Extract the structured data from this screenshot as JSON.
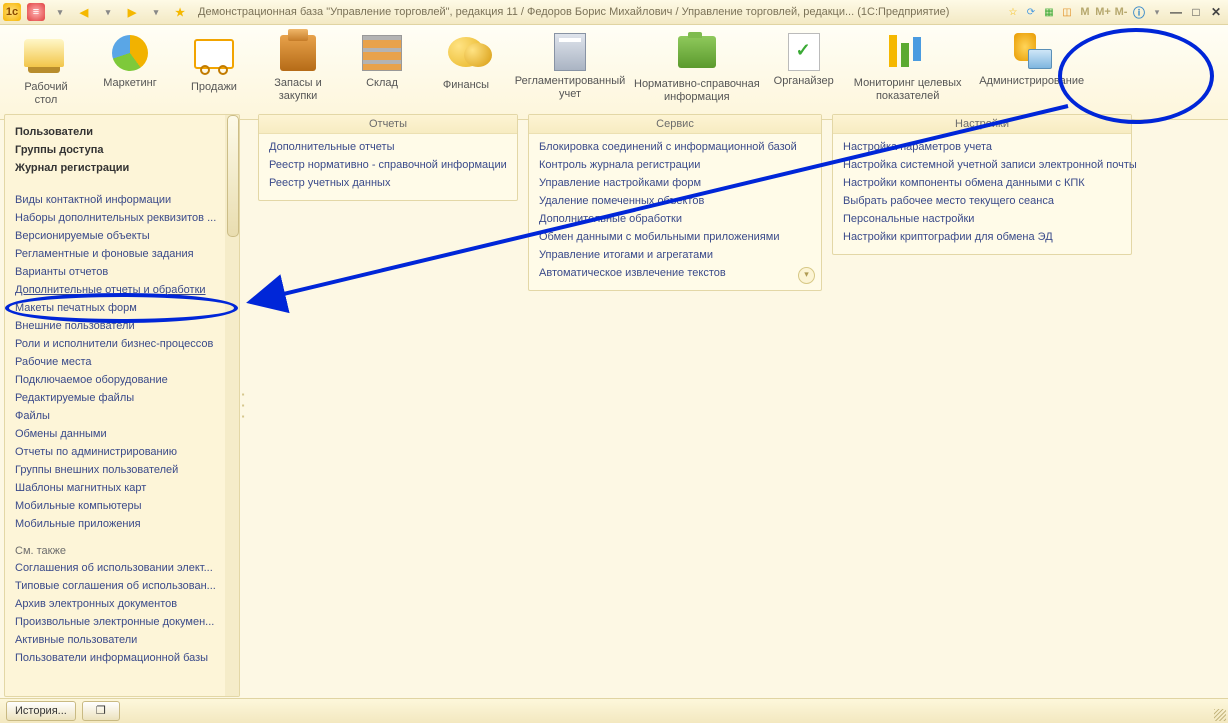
{
  "titlebar": {
    "title": "Демонстрационная база \"Управление торговлей\", редакция 11 / Федоров Борис Михайлович / Управление торговлей, редакци...   (1С:Предприятие)",
    "icons_right": {
      "m1": "M",
      "m2": "M+",
      "m3": "M-"
    }
  },
  "sections": [
    {
      "id": "desktop",
      "label": "Рабочий\nстол"
    },
    {
      "id": "marketing",
      "label": "Маркетинг"
    },
    {
      "id": "sales",
      "label": "Продажи"
    },
    {
      "id": "stock",
      "label": "Запасы и\nзакупки"
    },
    {
      "id": "warehouse",
      "label": "Склад"
    },
    {
      "id": "finance",
      "label": "Финансы"
    },
    {
      "id": "reglament",
      "label": "Регламентированный\nучет"
    },
    {
      "id": "nsi",
      "label": "Нормативно-справочная\nинформация"
    },
    {
      "id": "organizer",
      "label": "Органайзер"
    },
    {
      "id": "monitoring",
      "label": "Мониторинг целевых\nпоказателей"
    },
    {
      "id": "admin",
      "label": "Администрирование"
    }
  ],
  "nav": {
    "bold": [
      "Пользователи",
      "Группы доступа",
      "Журнал регистрации"
    ],
    "links1": [
      "Виды контактной информации",
      "Наборы дополнительных реквизитов ...",
      "Версионируемые объекты",
      "Регламентные и фоновые задания",
      "Варианты отчетов",
      "Дополнительные отчеты и обработки",
      "Макеты печатных форм",
      "Внешние пользователи",
      "Роли и исполнители бизнес-процессов",
      "Рабочие места",
      "Подключаемое оборудование",
      "Редактируемые файлы",
      "Файлы",
      "Обмены данными",
      "Отчеты по администрированию",
      "Группы внешних пользователей",
      "Шаблоны магнитных карт",
      "Мобильные компьютеры",
      "Мобильные приложения"
    ],
    "seealso_hd": "См. также",
    "links2": [
      "Соглашения об использовании элект...",
      "Типовые соглашения об использован...",
      "Архив электронных документов",
      "Произвольные электронные докумен...",
      "Активные пользователи",
      "Пользователи информационной базы"
    ]
  },
  "panels": {
    "reports": {
      "title": "Отчеты",
      "items": [
        "Дополнительные отчеты",
        "Реестр нормативно - справочной информации",
        "Реестр учетных данных"
      ]
    },
    "service": {
      "title": "Сервис",
      "items": [
        "Блокировка соединений с информационной базой",
        "Контроль журнала регистрации",
        "Управление настройками форм",
        "Удаление помеченных объектов",
        "Дополнительные обработки",
        "Обмен данными с мобильными приложениями",
        "Управление итогами и агрегатами",
        "Автоматическое извлечение текстов"
      ]
    },
    "settings": {
      "title": "Настройки",
      "items": [
        "Настройка параметров учета",
        "Настройка системной учетной записи электронной почты",
        "Настройки компоненты обмена данными с КПК",
        "Выбрать рабочее место текущего сеанса",
        "Персональные настройки",
        "Настройки криптографии для обмена ЭД"
      ]
    }
  },
  "status": {
    "history": "История..."
  }
}
